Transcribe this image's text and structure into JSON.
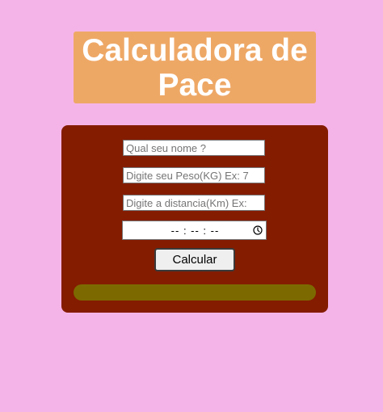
{
  "header": {
    "title": "Calculadora de Pace"
  },
  "form": {
    "name_placeholder": "Qual seu nome ?",
    "weight_placeholder": "Digite seu Peso(KG) Ex: 7",
    "distance_placeholder": "Digite a distancia(Km) Ex:",
    "time_value": "-- : -- : --",
    "time_icon": "clock-icon",
    "calculate_label": "Calcular",
    "result_text": ""
  },
  "colors": {
    "background": "#f5b4e8",
    "title_box": "#eea866",
    "panel": "#841c00",
    "result_bar": "#7c6a00"
  }
}
